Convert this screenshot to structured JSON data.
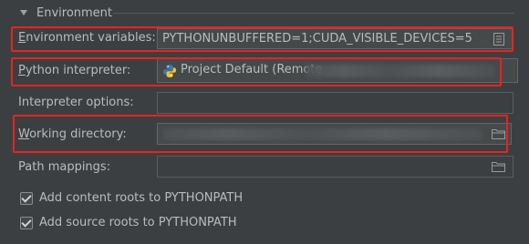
{
  "section": {
    "title": "Environment"
  },
  "env_vars": {
    "label_mnemonic": "E",
    "label_rest": "nvironment variables:",
    "value": "PYTHONUNBUFFERED=1;CUDA_VISIBLE_DEVICES=5"
  },
  "interpreter": {
    "label_mnemonic": "P",
    "label_rest": "ython interpreter:",
    "value": "Project Default (Remote"
  },
  "interpreter_options": {
    "label": "Interpreter options:",
    "value": ""
  },
  "working_dir": {
    "label_mnemonic": "W",
    "label_rest": "orking directory:"
  },
  "path_mappings": {
    "label": "Path mappings:",
    "value": ""
  },
  "checkboxes": [
    {
      "label": "Add content roots to PYTHONPATH",
      "checked": true
    },
    {
      "label": "Add source roots to PYTHONPATH",
      "checked": true
    }
  ],
  "colors": {
    "background": "#3c3f41",
    "highlight": "#e8231f",
    "text": "#bbbbbb"
  },
  "icons": {
    "expand": "triangle-down-icon",
    "env_edit": "document-icon",
    "interpreter": "python-icon",
    "browse": "folder-icon"
  }
}
